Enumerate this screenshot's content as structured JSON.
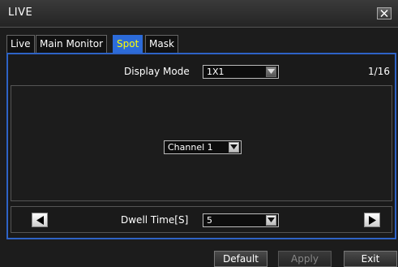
{
  "window": {
    "title": "LIVE"
  },
  "tabs": [
    {
      "label": "Live",
      "active": false
    },
    {
      "label": "Main Monitor",
      "active": false
    },
    {
      "label": "Spot",
      "active": true
    },
    {
      "label": "Mask",
      "active": false
    }
  ],
  "display_mode": {
    "label": "Display Mode",
    "value": "1X1"
  },
  "page_indicator": "1/16",
  "channel_select": {
    "value": "Channel 1"
  },
  "dwell_time": {
    "label": "Dwell Time[S]",
    "value": "5"
  },
  "buttons": {
    "default": "Default",
    "apply": "Apply",
    "exit": "Exit"
  },
  "colors": {
    "accent": "#2c6bd9",
    "active_tab_text": "#ffff00",
    "panel_border": "#2e63c6"
  },
  "icons": {
    "close": "close-icon",
    "prev": "triangle-left-icon",
    "next": "triangle-right-icon",
    "dropdown": "chevron-down-icon"
  }
}
